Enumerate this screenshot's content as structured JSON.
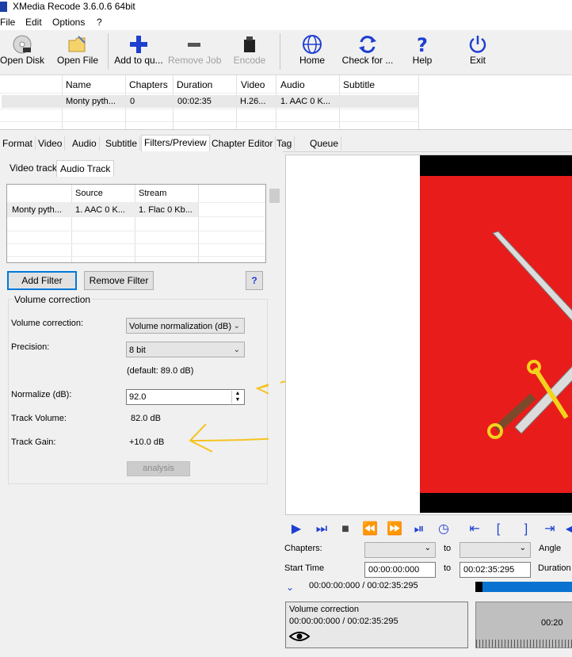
{
  "window": {
    "title": "XMedia Recode 3.6.0.6 64bit"
  },
  "menu": [
    "File",
    "Edit",
    "Options",
    "?"
  ],
  "toolbar": {
    "open_disk": "Open Disk",
    "open_file": "Open File",
    "add_to_queue": "Add to qu...",
    "remove_job": "Remove Job",
    "encode": "Encode",
    "home": "Home",
    "check_for_updates": "Check for ...",
    "help": "Help",
    "exit": "Exit"
  },
  "filelist": {
    "headers": [
      "Name",
      "Chapters",
      "Duration",
      "Video",
      "Audio",
      "Subtitle"
    ],
    "row": [
      "Monty pyth...",
      "0",
      "00:02:35",
      "H.26...",
      "1. AAC  0 K...",
      ""
    ]
  },
  "tabs": [
    "Format",
    "Video",
    "Audio",
    "Subtitle",
    "Filters/Preview",
    "Chapter Editor",
    "Tag",
    "Queue"
  ],
  "subtabs": [
    "Video track",
    "Audio Track"
  ],
  "tracklist": {
    "headers": [
      "",
      "Source",
      "Stream"
    ],
    "row": [
      "Monty pyth...",
      "1. AAC  0 K...",
      "1. Flac 0 Kb..."
    ]
  },
  "buttons": {
    "add_filter": "Add Filter",
    "remove_filter": "Remove Filter",
    "help": "?"
  },
  "volume": {
    "group_label": "Volume correction",
    "volume_correction_label": "Volume correction:",
    "volume_correction_value": "Volume normalization (dB)",
    "precision_label": "Precision:",
    "precision_value": "8 bit",
    "default_note": "(default: 89.0 dB)",
    "normalize_label": "Normalize (dB):",
    "normalize_value": "92.0",
    "track_volume_label": "Track Volume:",
    "track_volume_value": "82.0 dB",
    "track_gain_label": "Track Gain:",
    "track_gain_value": "+10.0 dB",
    "analysis_button": "analysis"
  },
  "player": {
    "chapters_label": "Chapters:",
    "to1": "to",
    "angle_label": "Angle",
    "start_time_label": "Start Time",
    "start_time_value": "00:00:00:000",
    "to2": "to",
    "end_time_value": "00:02:35:295",
    "duration_label": "Duration",
    "position_text": "00:00:00:000 / 00:02:35:295",
    "info_title": "Volume correction",
    "info_time": "00:00:00:000 / 00:02:35:295",
    "wave_time": "00:20"
  },
  "colors": {
    "accent": "#1e3fd0",
    "annotation": "#f6c320",
    "video_red": "#e91c1c",
    "progress": "#0a72d0"
  }
}
